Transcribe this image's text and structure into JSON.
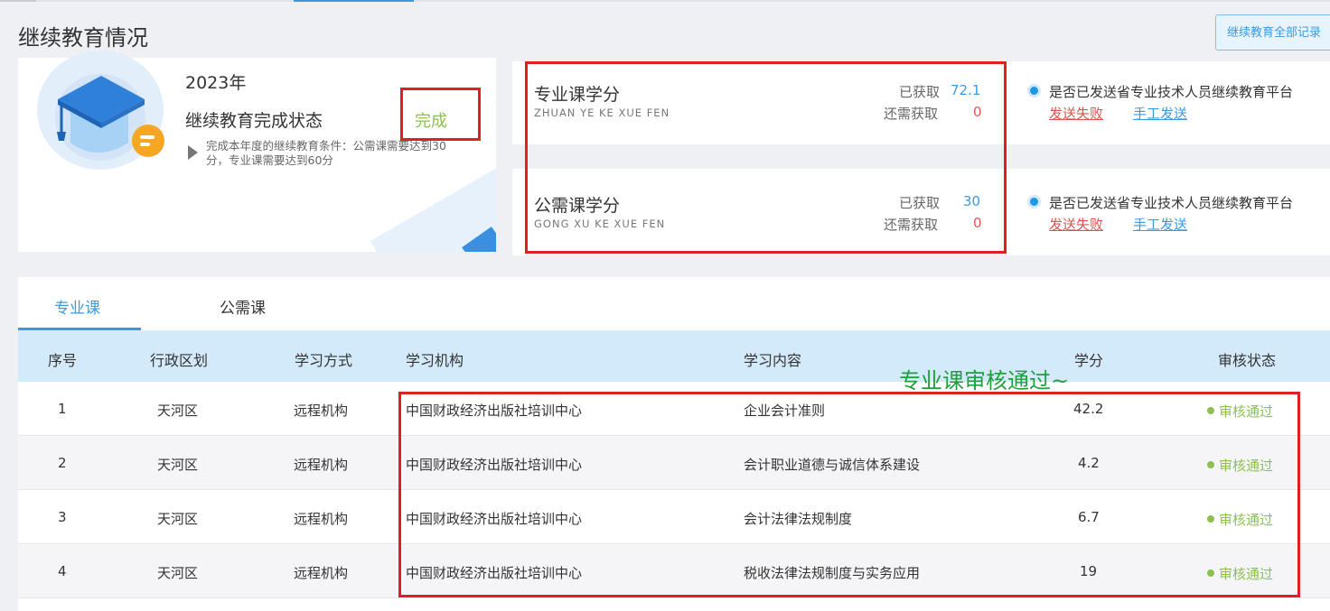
{
  "page": {
    "title": "继续教育情况",
    "all_records_button": "继续教育全部记录"
  },
  "status_card": {
    "year": "2023年",
    "label": "继续教育完成状态",
    "value": "完成",
    "condition": "完成本年度的继续教育条件：公需课需要达到30分，专业课需要达到60分"
  },
  "credits": [
    {
      "title": "专业课学分",
      "pinyin": "ZHUAN YE KE XUE FEN",
      "got_label": "已获取",
      "got_value": "72.1",
      "need_label": "还需获取",
      "need_value": "0",
      "send_question": "是否已发送省专业技术人员继续教育平台",
      "send_fail": "发送失败",
      "send_manual": "手工发送"
    },
    {
      "title": "公需课学分",
      "pinyin": "GONG XU KE XUE FEN",
      "got_label": "已获取",
      "got_value": "30",
      "need_label": "还需获取",
      "need_value": "0",
      "send_question": "是否已发送省专业技术人员继续教育平台",
      "send_fail": "发送失败",
      "send_manual": "手工发送"
    }
  ],
  "tabs": [
    "专业课",
    "公需课"
  ],
  "table": {
    "headers": [
      "序号",
      "行政区划",
      "学习方式",
      "学习机构",
      "学习内容",
      "学分",
      "审核状态"
    ],
    "rows": [
      [
        "1",
        "天河区",
        "远程机构",
        "中国财政经济出版社培训中心",
        "企业会计准则",
        "42.2",
        "审核通过"
      ],
      [
        "2",
        "天河区",
        "远程机构",
        "中国财政经济出版社培训中心",
        "会计职业道德与诚信体系建设",
        "4.2",
        "审核通过"
      ],
      [
        "3",
        "天河区",
        "远程机构",
        "中国财政经济出版社培训中心",
        "会计法律法规制度",
        "6.7",
        "审核通过"
      ],
      [
        "4",
        "天河区",
        "远程机构",
        "中国财政经济出版社培训中心",
        "税收法律法规制度与实务应用",
        "19",
        "审核通过"
      ]
    ]
  },
  "annotation": {
    "text": "专业课审核通过~"
  },
  "colors": {
    "accent": "#3a9ae0",
    "success": "#8cc152",
    "danger": "#e05a4d",
    "annotation_border": "#e02020",
    "annotation_text": "#1da13a"
  }
}
